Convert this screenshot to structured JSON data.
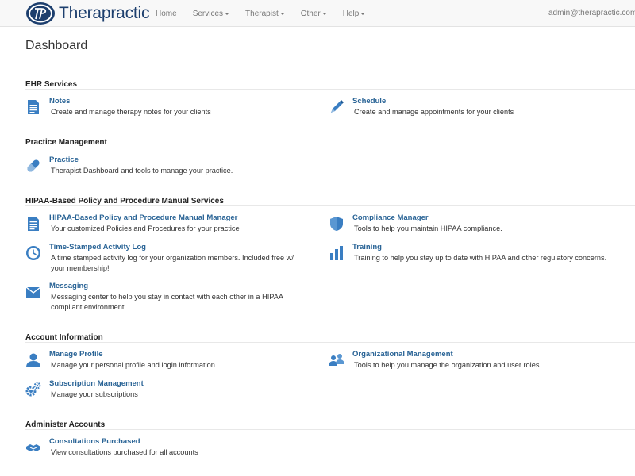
{
  "app": {
    "brand": "Therapractic",
    "nav": [
      {
        "label": "Home",
        "dropdown": false
      },
      {
        "label": "Services",
        "dropdown": true
      },
      {
        "label": "Therapist",
        "dropdown": true
      },
      {
        "label": "Other",
        "dropdown": true
      },
      {
        "label": "Help",
        "dropdown": true
      }
    ],
    "user": "admin@therapractic.com",
    "accent": "#2a6496"
  },
  "page": {
    "title": "Dashboard"
  },
  "sections": {
    "ehr": {
      "title": "EHR Services",
      "items": {
        "notes": {
          "title": "Notes",
          "desc": "Create and manage therapy notes for your clients",
          "icon": "document-icon"
        },
        "schedule": {
          "title": "Schedule",
          "desc": "Create and manage appointments for your clients",
          "icon": "pencil-icon"
        }
      }
    },
    "practice": {
      "title": "Practice Management",
      "items": {
        "practice": {
          "title": "Practice",
          "desc": "Therapist Dashboard and tools to manage your practice.",
          "icon": "pill-icon"
        }
      }
    },
    "hipaa": {
      "title": "HIPAA-Based Policy and Procedure Manual Services",
      "items": {
        "manual": {
          "title": "HIPAA-Based Policy and Procedure Manual Manager",
          "desc": "Your customized Policies and Procedures for your practice",
          "icon": "document-icon"
        },
        "compliance": {
          "title": "Compliance Manager",
          "desc": "Tools to help you maintain HIPAA compliance.",
          "icon": "shield-icon"
        },
        "activity": {
          "title": "Time-Stamped Activity Log",
          "desc": "A time stamped activity log for your organization members. Included free w/ your membership!",
          "icon": "clock-icon"
        },
        "training": {
          "title": "Training",
          "desc": "Training to help you stay up to date with HIPAA and other regulatory concerns.",
          "icon": "bar-chart-icon"
        },
        "messaging": {
          "title": "Messaging",
          "desc": "Messaging center to help you stay in contact with each other in a HIPAA compliant environment.",
          "icon": "envelope-icon"
        }
      }
    },
    "account": {
      "title": "Account Information",
      "items": {
        "profile": {
          "title": "Manage Profile",
          "desc": "Manage your personal profile and login information",
          "icon": "user-icon"
        },
        "org": {
          "title": "Organizational Management",
          "desc": "Tools to help you manage the organization and user roles",
          "icon": "users-icon"
        },
        "subscription": {
          "title": "Subscription Management",
          "desc": "Manage your subscriptions",
          "icon": "gears-icon"
        }
      }
    },
    "admin": {
      "title": "Administer Accounts",
      "items": {
        "consultations": {
          "title": "Consultations Purchased",
          "desc": "View consultations purchased for all accounts",
          "icon": "handshake-icon"
        }
      }
    }
  }
}
